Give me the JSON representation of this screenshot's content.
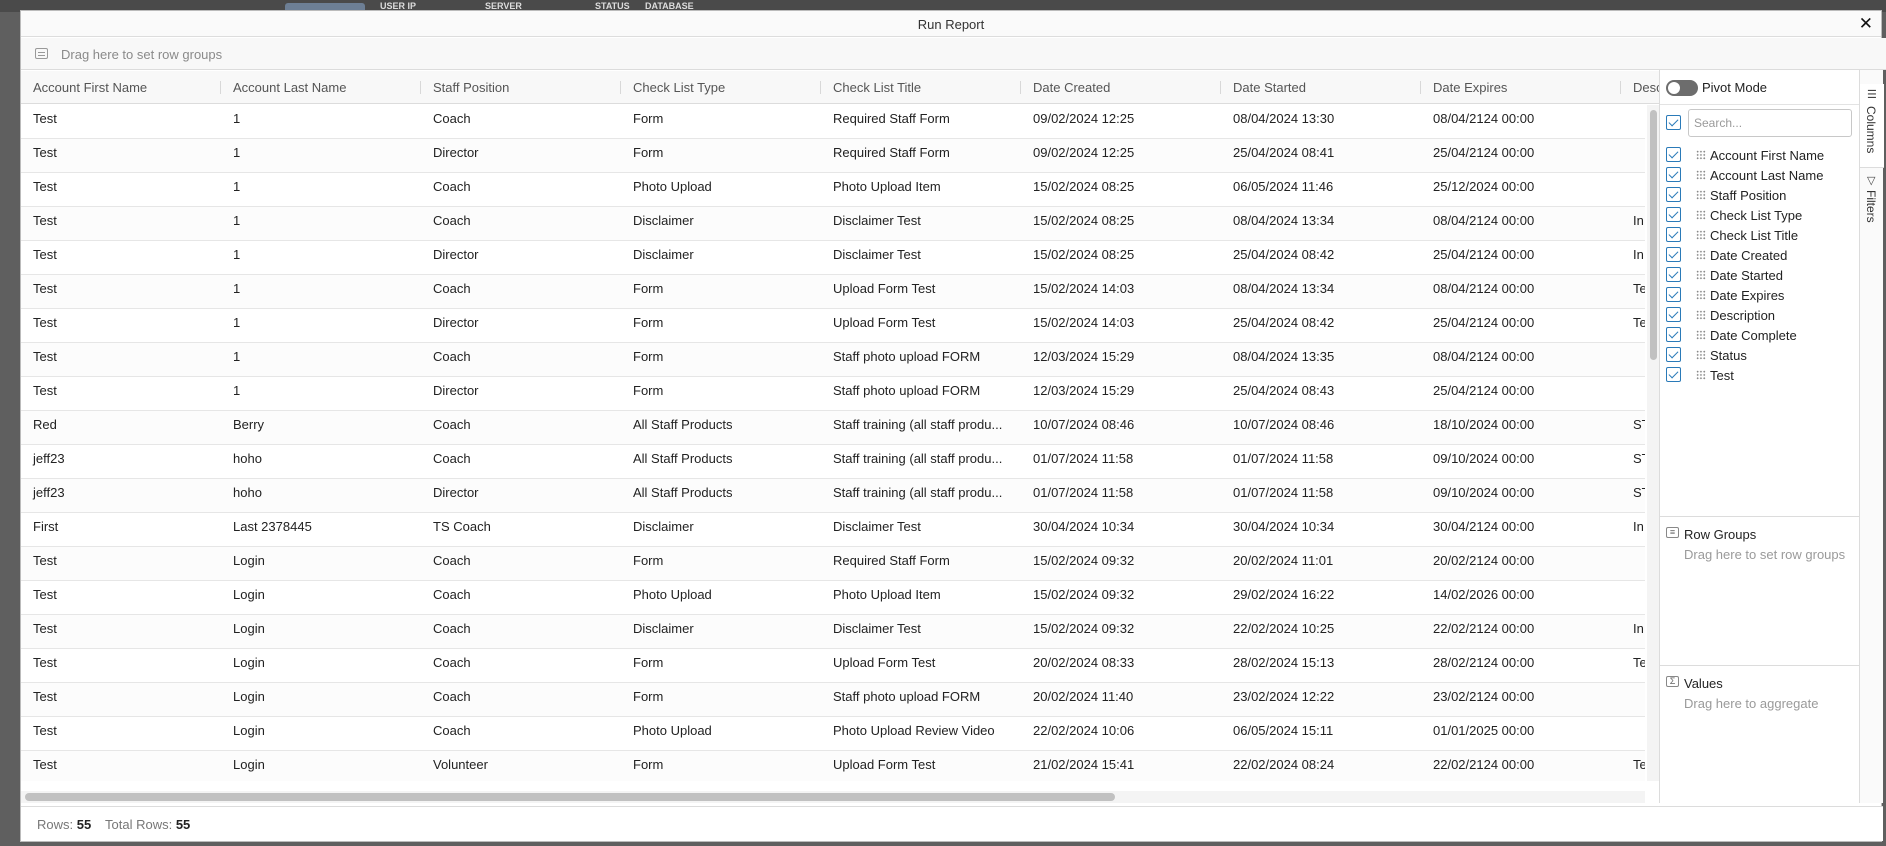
{
  "background": {
    "headers": [
      "USER IP",
      "SERVER",
      "STATUS",
      "DATABASE"
    ]
  },
  "modal": {
    "title": "Run Report"
  },
  "group_bar": {
    "hint": "Drag here to set row groups"
  },
  "columns": [
    "Account First Name",
    "Account Last Name",
    "Staff Position",
    "Check List Type",
    "Check List Title",
    "Date Created",
    "Date Started",
    "Date Expires",
    "Description"
  ],
  "rows": [
    [
      "Test",
      "1",
      "Coach",
      "Form",
      "Required Staff Form",
      "09/02/2024 12:25",
      "08/04/2024 13:30",
      "08/04/2124 00:00",
      ""
    ],
    [
      "Test",
      "1",
      "Director",
      "Form",
      "Required Staff Form",
      "09/02/2024 12:25",
      "25/04/2024 08:41",
      "25/04/2124 00:00",
      ""
    ],
    [
      "Test",
      "1",
      "Coach",
      "Photo Upload",
      "Photo Upload Item",
      "15/02/2024 08:25",
      "06/05/2024 11:46",
      "25/12/2024 00:00",
      ""
    ],
    [
      "Test",
      "1",
      "Coach",
      "Disclaimer",
      "Disclaimer Test",
      "15/02/2024 08:25",
      "08/04/2024 13:34",
      "08/04/2124 00:00",
      "In"
    ],
    [
      "Test",
      "1",
      "Director",
      "Disclaimer",
      "Disclaimer Test",
      "15/02/2024 08:25",
      "25/04/2024 08:42",
      "25/04/2124 00:00",
      "In"
    ],
    [
      "Test",
      "1",
      "Coach",
      "Form",
      "Upload Form Test",
      "15/02/2024 14:03",
      "08/04/2024 13:34",
      "08/04/2124 00:00",
      "Te"
    ],
    [
      "Test",
      "1",
      "Director",
      "Form",
      "Upload Form Test",
      "15/02/2024 14:03",
      "25/04/2024 08:42",
      "25/04/2124 00:00",
      "Te"
    ],
    [
      "Test",
      "1",
      "Coach",
      "Form",
      "Staff photo upload FORM",
      "12/03/2024 15:29",
      "08/04/2024 13:35",
      "08/04/2124 00:00",
      ""
    ],
    [
      "Test",
      "1",
      "Director",
      "Form",
      "Staff photo upload FORM",
      "12/03/2024 15:29",
      "25/04/2024 08:43",
      "25/04/2124 00:00",
      ""
    ],
    [
      "Red",
      "Berry",
      "Coach",
      "All Staff Products",
      "Staff training (all staff produ...",
      "10/07/2024 08:46",
      "10/07/2024 08:46",
      "18/10/2024 00:00",
      "ST"
    ],
    [
      "jeff23",
      "hoho",
      "Coach",
      "All Staff Products",
      "Staff training (all staff produ...",
      "01/07/2024 11:58",
      "01/07/2024 11:58",
      "09/10/2024 00:00",
      "ST"
    ],
    [
      "jeff23",
      "hoho",
      "Director",
      "All Staff Products",
      "Staff training (all staff produ...",
      "01/07/2024 11:58",
      "01/07/2024 11:58",
      "09/10/2024 00:00",
      "ST"
    ],
    [
      "First",
      "Last 2378445",
      "TS Coach",
      "Disclaimer",
      "Disclaimer Test",
      "30/04/2024 10:34",
      "30/04/2024 10:34",
      "30/04/2124 00:00",
      "In"
    ],
    [
      "Test",
      "Login",
      "Coach",
      "Form",
      "Required Staff Form",
      "15/02/2024 09:32",
      "20/02/2024 11:01",
      "20/02/2124 00:00",
      ""
    ],
    [
      "Test",
      "Login",
      "Coach",
      "Photo Upload",
      "Photo Upload Item",
      "15/02/2024 09:32",
      "29/02/2024 16:22",
      "14/02/2026 00:00",
      ""
    ],
    [
      "Test",
      "Login",
      "Coach",
      "Disclaimer",
      "Disclaimer Test",
      "15/02/2024 09:32",
      "22/02/2024 10:25",
      "22/02/2124 00:00",
      "In"
    ],
    [
      "Test",
      "Login",
      "Coach",
      "Form",
      "Upload Form Test",
      "20/02/2024 08:33",
      "28/02/2024 15:13",
      "28/02/2124 00:00",
      "Te"
    ],
    [
      "Test",
      "Login",
      "Coach",
      "Form",
      "Staff photo upload FORM",
      "20/02/2024 11:40",
      "23/02/2024 12:22",
      "23/02/2124 00:00",
      ""
    ],
    [
      "Test",
      "Login",
      "Coach",
      "Photo Upload",
      "Photo Upload Review Video",
      "22/02/2024 10:06",
      "06/05/2024 15:11",
      "01/01/2025 00:00",
      ""
    ],
    [
      "Test",
      "Login",
      "Volunteer",
      "Form",
      "Upload Form Test",
      "21/02/2024 15:41",
      "22/02/2024 08:24",
      "22/02/2124 00:00",
      "Te"
    ]
  ],
  "sidebar": {
    "pivot_label": "Pivot Mode",
    "search_placeholder": "Search...",
    "column_list": [
      "Account First Name",
      "Account Last Name",
      "Staff Position",
      "Check List Type",
      "Check List Title",
      "Date Created",
      "Date Started",
      "Date Expires",
      "Description",
      "Date Complete",
      "Status",
      "Test"
    ],
    "row_groups_title": "Row Groups",
    "row_groups_hint": "Drag here to set row groups",
    "values_title": "Values",
    "values_hint": "Drag here to aggregate",
    "tabs": [
      "Columns",
      "Filters"
    ]
  },
  "status": {
    "rows_label": "Rows:",
    "rows_value": "55",
    "total_label": "Total Rows:",
    "total_value": "55"
  }
}
